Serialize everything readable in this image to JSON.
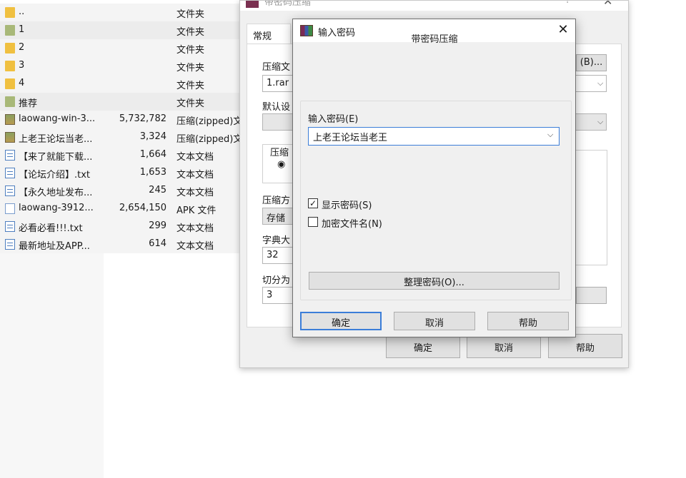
{
  "explorer": {
    "files": [
      {
        "name": "..",
        "size": "",
        "type": "文件夹",
        "icon": "folder-icon"
      },
      {
        "name": "1",
        "size": "",
        "type": "文件夹",
        "icon": "folder-icon"
      },
      {
        "name": "2",
        "size": "",
        "type": "文件夹",
        "icon": "folder-icon"
      },
      {
        "name": "3",
        "size": "",
        "type": "文件夹",
        "icon": "folder-icon"
      },
      {
        "name": "4",
        "size": "",
        "type": "文件夹",
        "icon": "folder-icon"
      },
      {
        "name": "推荐",
        "size": "",
        "type": "文件夹",
        "icon": "folder-icon"
      },
      {
        "name": "laowang-win-3...",
        "size": "5,732,782",
        "type": "压缩(zipped)文件夹",
        "icon": "archive-icon"
      },
      {
        "name": "上老王论坛当老...",
        "size": "3,324",
        "type": "压缩(zipped)文件夹",
        "icon": "archive-icon"
      },
      {
        "name": "【来了就能下载...",
        "size": "1,664",
        "type": "文本文档",
        "icon": "text-document-icon"
      },
      {
        "name": "【论坛介绍】.txt",
        "size": "1,653",
        "type": "文本文档",
        "icon": "text-document-icon"
      },
      {
        "name": "【永久地址发布...",
        "size": "245",
        "type": "文本文档",
        "icon": "text-document-icon"
      },
      {
        "name": "laowang-3912...",
        "size": "2,654,150",
        "type": "APK 文件",
        "icon": "apk-file-icon"
      },
      {
        "name": "必看必看!!!.txt",
        "size": "299",
        "type": "文本文档",
        "icon": "text-document-icon"
      },
      {
        "name": "最新地址及APP...",
        "size": "614",
        "type": "文本文档",
        "icon": "text-document-icon"
      }
    ]
  },
  "back_dialog": {
    "title": "带密码压缩",
    "help_glyph": "?",
    "close_glyph": "✕",
    "tab_general": "常规",
    "archive_name_label": "压缩文",
    "archive_name_value": "1.rar",
    "browse_button": "(B)...",
    "default_profile_label": "默认设",
    "format_group_label": "压缩",
    "method_label": "压缩方",
    "method_value": "存储",
    "dict_label": "字典大",
    "dict_value": "32",
    "split_label": "切分为",
    "split_value": "3",
    "ok": "确定",
    "cancel": "取消",
    "help": "帮助"
  },
  "password_dialog": {
    "title": "输入密码",
    "heading": "带密码压缩",
    "password_label": "输入密码(E)",
    "password_value": "上老王论坛当老王",
    "show_password_label": "显示密码(S)",
    "show_password_checked": true,
    "encrypt_names_label": "加密文件名(N)",
    "encrypt_names_checked": false,
    "organize_button": "整理密码(O)...",
    "ok": "确定",
    "cancel": "取消",
    "help": "帮助",
    "close_glyph": "✕"
  }
}
